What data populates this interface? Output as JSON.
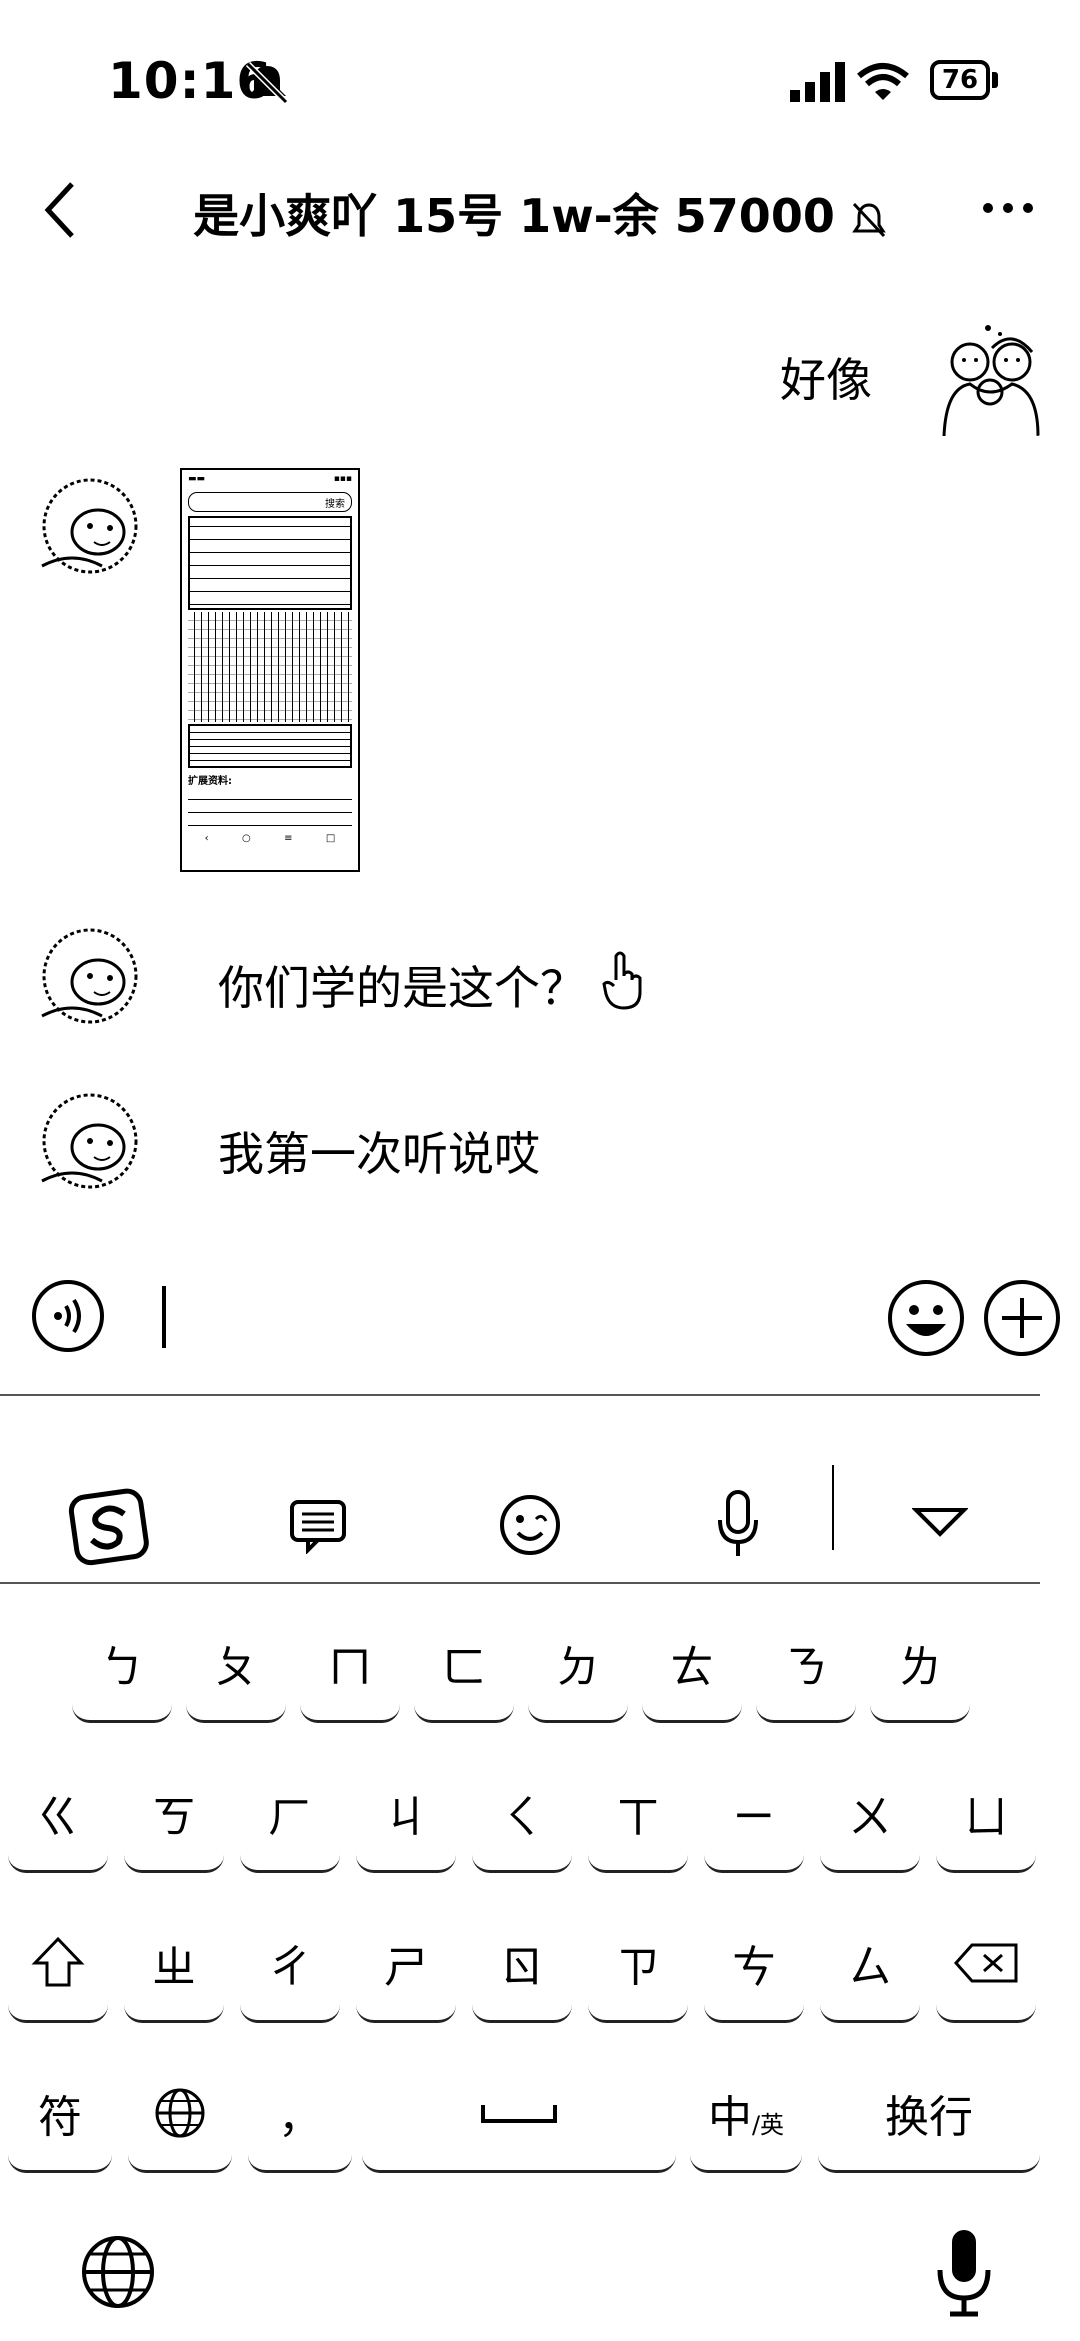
{
  "status_bar": {
    "time": "10:16",
    "battery": "76"
  },
  "nav": {
    "title": "是小爽吖 15号 1w-余 57000"
  },
  "messages": [
    {
      "side": "right",
      "type": "text",
      "text": "好像"
    },
    {
      "side": "left",
      "type": "image"
    },
    {
      "side": "left",
      "type": "text",
      "text": "你们学的是这个？"
    },
    {
      "side": "left",
      "type": "text",
      "text": "我第一次听说哎"
    }
  ],
  "input": {
    "value": ""
  },
  "keyboard": {
    "row1": [
      "ㄅ",
      "ㄆ",
      "ㄇ",
      "ㄈ",
      "ㄉ",
      "ㄊ",
      "ㄋ",
      "ㄌ"
    ],
    "row2": [
      "ㄍ",
      "ㄎ",
      "ㄏ",
      "ㄐ",
      "ㄑ",
      "ㄒ",
      "ㄧ",
      "ㄨ",
      "ㄩ"
    ],
    "row3": [
      "ㄓ",
      "ㄔ",
      "ㄕ",
      "ㄖ",
      "ㄗ",
      "ㄘ",
      "ㄙ"
    ],
    "bottom": {
      "symbols": "符",
      "comma": "，",
      "chinese": "中",
      "english_sub": "/英",
      "enter": "换行"
    }
  },
  "thumbnail": {
    "search_label": "搜索",
    "caption": "扩展资料:"
  }
}
